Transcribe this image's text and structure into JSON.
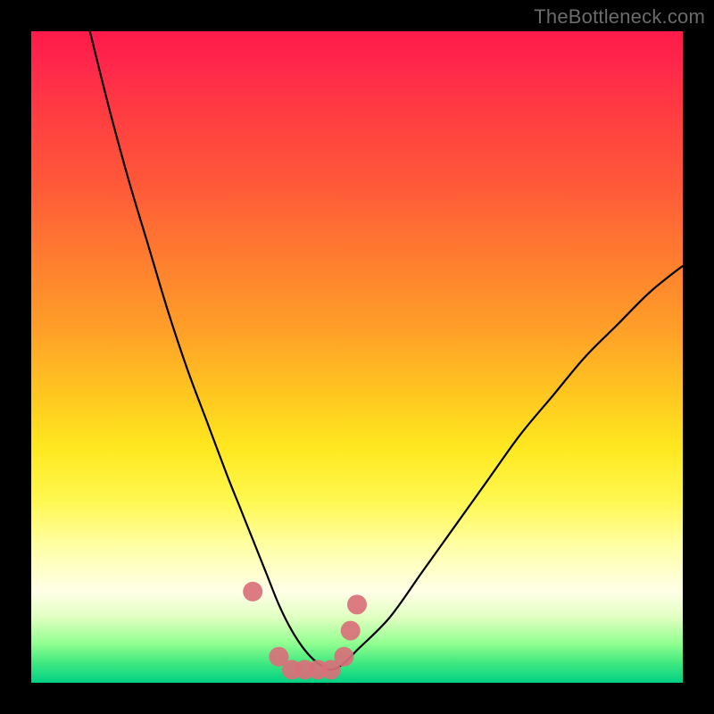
{
  "watermark": "TheBottleneck.com",
  "colors": {
    "background": "#000000",
    "curve": "#000000",
    "marker": "#d9707a",
    "gradient_stops": [
      "#ff1a4a",
      "#ff7a30",
      "#ffe820",
      "#ffffe8",
      "#00d084"
    ]
  },
  "chart_data": {
    "type": "line",
    "title": "",
    "xlabel": "",
    "ylabel": "",
    "xlim": [
      0,
      100
    ],
    "ylim": [
      0,
      100
    ],
    "series": [
      {
        "name": "bottleneck-curve",
        "x": [
          9,
          12,
          15,
          18,
          21,
          24,
          27,
          30,
          32,
          34,
          36,
          38,
          40,
          42,
          44,
          46,
          48,
          50,
          55,
          60,
          65,
          70,
          75,
          80,
          85,
          90,
          95,
          100
        ],
        "y": [
          100,
          88,
          77,
          67,
          57,
          48,
          40,
          32,
          27,
          22,
          17,
          12,
          8,
          5,
          3,
          2,
          3,
          5,
          10,
          17,
          24,
          31,
          38,
          44,
          50,
          55,
          60,
          64
        ]
      }
    ],
    "markers": {
      "name": "highlighted-points",
      "x": [
        34,
        38,
        40,
        42,
        44,
        46,
        48,
        49,
        50
      ],
      "y": [
        14,
        4,
        2,
        2,
        2,
        2,
        4,
        8,
        12
      ]
    }
  }
}
